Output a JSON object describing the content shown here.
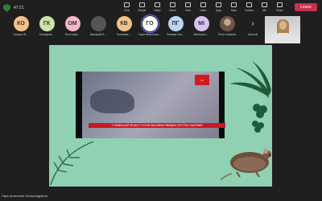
{
  "meeting": {
    "timer": "47:21"
  },
  "participants": [
    {
      "initials": "КО",
      "name": "Калаш Ю...",
      "bg": "#f2c18a"
    },
    {
      "initials": "ГК",
      "name": "Гончаров...",
      "bg": "#c9e4a6"
    },
    {
      "initials": "ОМ",
      "name": "Охотника...",
      "bg": "#f4b8c8"
    },
    {
      "initials": "",
      "name": "Шамрай Л...",
      "bg": "#555555",
      "photo": "dark"
    },
    {
      "initials": "КВ",
      "name": "Коломиє...",
      "bg": "#f2c18a"
    },
    {
      "initials": "ГО",
      "name": "Гара Анастасія...",
      "bg": "#ffffff",
      "active": true
    },
    {
      "initials": "ПГ",
      "name": "Попова Гал...",
      "bg": "#b9d7f2"
    },
    {
      "initials": "МІ",
      "name": "Мельник І...",
      "bg": "#d7c2f2"
    },
    {
      "initials": "",
      "name": "Пєтя Наталія",
      "bg": "#777777",
      "photo": "person"
    }
  ],
  "view_all_label": "View all",
  "toolbar": [
    {
      "label": "Chat",
      "name": "chat-button"
    },
    {
      "label": "People",
      "name": "people-button"
    },
    {
      "label": "Raise",
      "name": "raise-button"
    },
    {
      "label": "React",
      "name": "react-button"
    },
    {
      "label": "View",
      "name": "view-button"
    },
    {
      "label": "Notes",
      "name": "notes-button"
    },
    {
      "label": "Apps",
      "name": "apps-button"
    },
    {
      "label": "More",
      "name": "more-button"
    },
    {
      "label": "Camera",
      "name": "camera-button"
    },
    {
      "label": "Mic",
      "name": "mic-button"
    },
    {
      "label": "Share",
      "name": "share-button"
    }
  ],
  "leave_label": "Leave",
  "video": {
    "ticker": "У ЛЬВІВСЬКІЙ ОБЛАСТІ СТАЛИ МАСОВИМ ЯВИЩЕМ ЗУСТРІЧІ З ЩУРАМИ",
    "logo": "24"
  },
  "presenter_name": "Гара Анастасія Олександрівна",
  "colors": {
    "share_bg": "#8fd1b2",
    "leave": "#c4314b",
    "ticker": "#c41a24"
  }
}
